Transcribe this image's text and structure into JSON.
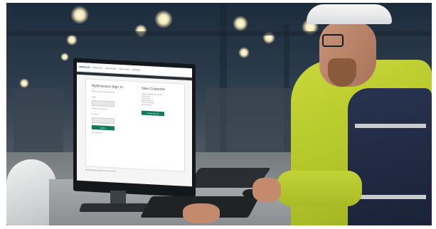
{
  "screen": {
    "logo": "EMERSON",
    "nav_links": [
      "PRODUCTS",
      "INDUSTRIES",
      "SOLUTIONS",
      "SUPPORT"
    ],
    "signin": {
      "title": "MyEmerson Sign In",
      "intro": "Sign in with your existing account",
      "email_label": "Email",
      "forgot_text": "Forgot your password?",
      "password_label": "Password",
      "button_label": "Sign In",
      "register_link": "Not registered?"
    },
    "new_customer": {
      "title": "New Customer",
      "intro": "Create a MyEmerson account",
      "bullets": [
        "View pricing",
        "Track orders",
        "Manage account",
        "Access documents",
        "Save favorites"
      ],
      "button_label": "Create Account"
    },
    "footer_text": "By proceeding you agree to the terms of use"
  },
  "colors": {
    "brand_green": "#127a5c",
    "brand_blue": "#1a4f8a",
    "hi_vis_yellow": "#c9d73a"
  }
}
